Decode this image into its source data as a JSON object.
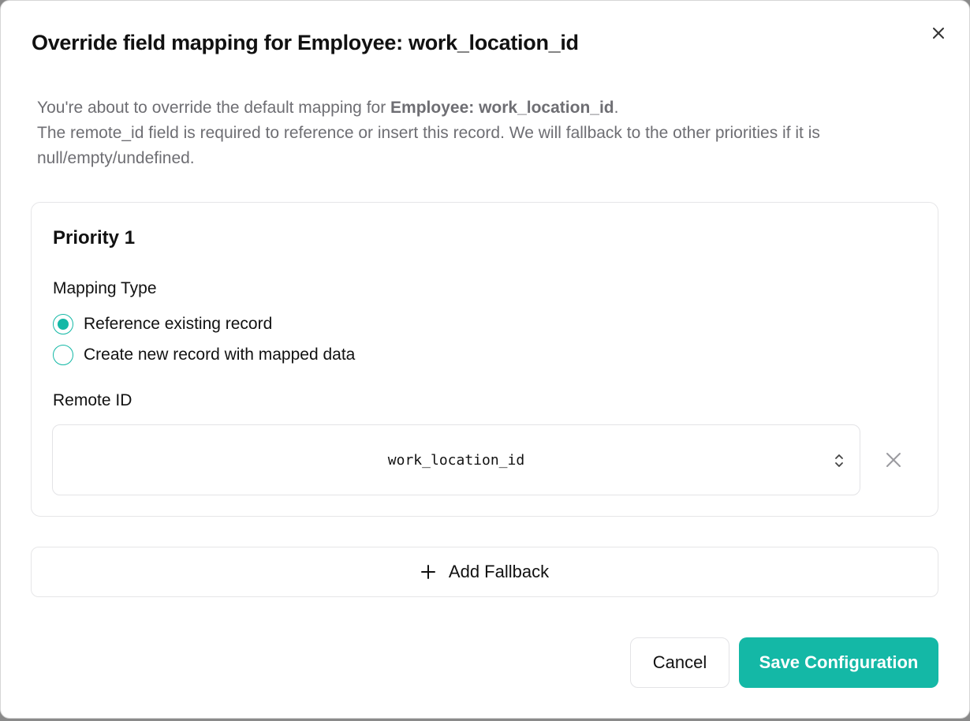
{
  "dialog": {
    "title": "Override field mapping for Employee: work_location_id",
    "description": {
      "line1_prefix": "You're about to override the default mapping for ",
      "line1_bold": "Employee: work_location_id",
      "line1_suffix": ".",
      "line2": "The remote_id field is required to reference or insert this record. We will fallback to the other priorities if it is null/empty/undefined."
    }
  },
  "priority": {
    "title": "Priority 1",
    "mapping_type_label": "Mapping Type",
    "options": [
      {
        "label": "Reference existing record",
        "selected": true
      },
      {
        "label": "Create new record with mapped data",
        "selected": false
      }
    ],
    "remote_id_label": "Remote ID",
    "remote_id_value": "work_location_id"
  },
  "add_fallback_label": "Add Fallback",
  "buttons": {
    "cancel": "Cancel",
    "save": "Save Configuration"
  },
  "icons": {
    "close": "close-icon",
    "select": "chevron-up-down-icon",
    "remove": "close-icon",
    "add": "plus-icon"
  },
  "colors": {
    "accent": "#14b8a6",
    "muted_text": "#6e6e73",
    "border": "#e6e6e8"
  }
}
